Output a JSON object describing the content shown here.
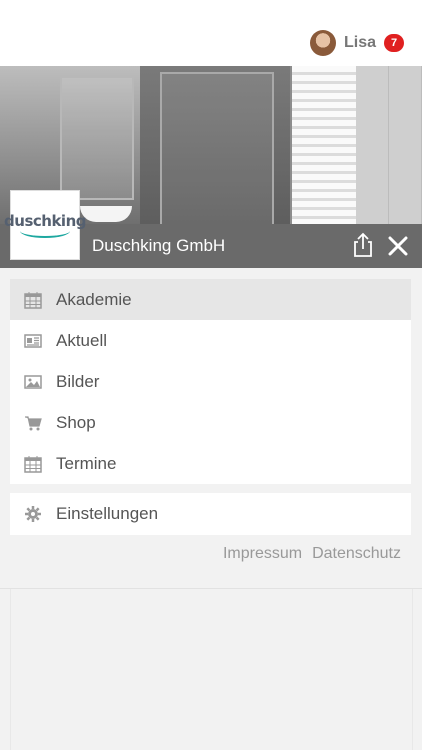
{
  "header": {
    "user_name": "Lisa",
    "notification_count": "7"
  },
  "company": {
    "name": "Duschking GmbH",
    "logo_text": "duschking"
  },
  "menu": {
    "items": [
      {
        "label": "Akademie",
        "icon": "calendar-icon",
        "active": true
      },
      {
        "label": "Aktuell",
        "icon": "newspaper-icon",
        "active": false
      },
      {
        "label": "Bilder",
        "icon": "image-icon",
        "active": false
      },
      {
        "label": "Shop",
        "icon": "cart-icon",
        "active": false
      },
      {
        "label": "Termine",
        "icon": "calendar-icon",
        "active": false
      }
    ],
    "settings_label": "Einstellungen"
  },
  "footer": {
    "impressum": "Impressum",
    "datenschutz": "Datenschutz"
  },
  "colors": {
    "title_bar": "#6a6a6a",
    "badge": "#e02020",
    "active_item": "#e6e6e6"
  }
}
